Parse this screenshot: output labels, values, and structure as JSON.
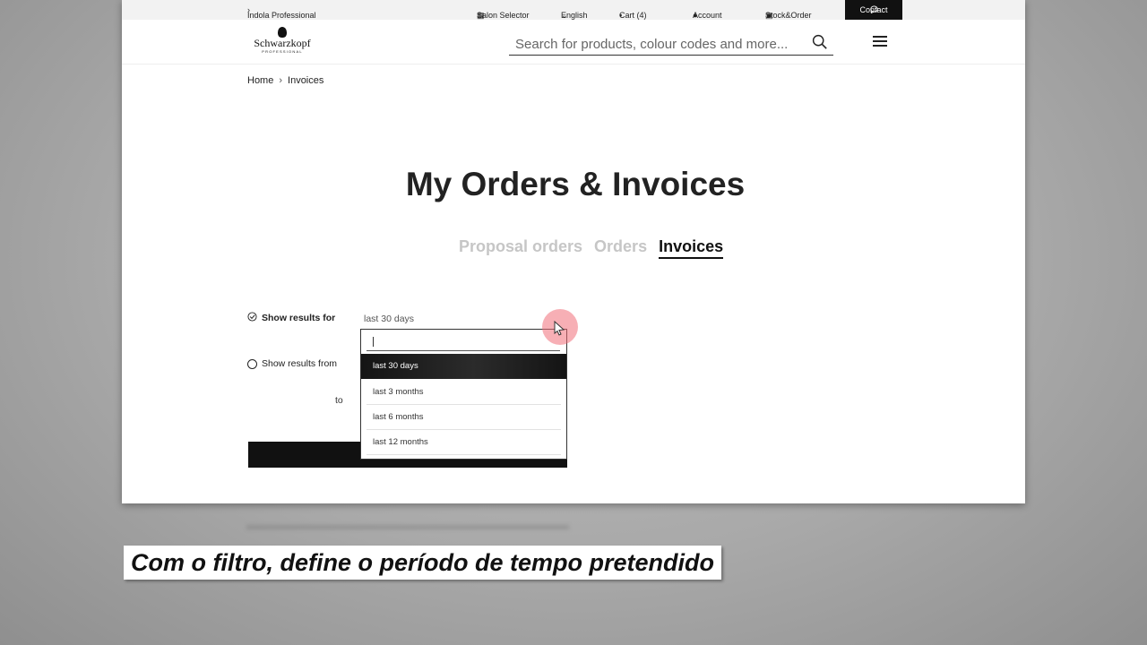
{
  "topbar": {
    "brand_link": "Indola Professional",
    "salon_selector": "Salon Selector",
    "language": "English",
    "cart": "Cart (4)",
    "account": "Account",
    "stock_order": "Stock&Order",
    "contact": "Contact"
  },
  "header": {
    "logo_brand": "Schwarzkopf",
    "logo_sub": "PROFESSIONAL",
    "search_placeholder": "Search for products, colour codes and more..."
  },
  "breadcrumb": [
    "Home",
    "Invoices"
  ],
  "page_title": "My Orders & Invoices",
  "tabs": [
    {
      "label": "Proposal orders",
      "active": false
    },
    {
      "label": "Orders",
      "active": false
    },
    {
      "label": "Invoices",
      "active": true
    }
  ],
  "filter": {
    "show_results_for_label": "Show results for",
    "selected_period": "last 30 days",
    "show_results_from_label": "Show results from",
    "to_label": "to",
    "options": [
      "last 30 days",
      "last 3 months",
      "last 6 months",
      "last 12 months"
    ],
    "highlighted_option": "last 30 days"
  },
  "caption": "Com o filtro, define o período de tempo pretendido",
  "colors": {
    "accent_dark": "#111111",
    "inactive_tab": "#c6c6c6",
    "cursor_highlight": "#f06e78"
  }
}
